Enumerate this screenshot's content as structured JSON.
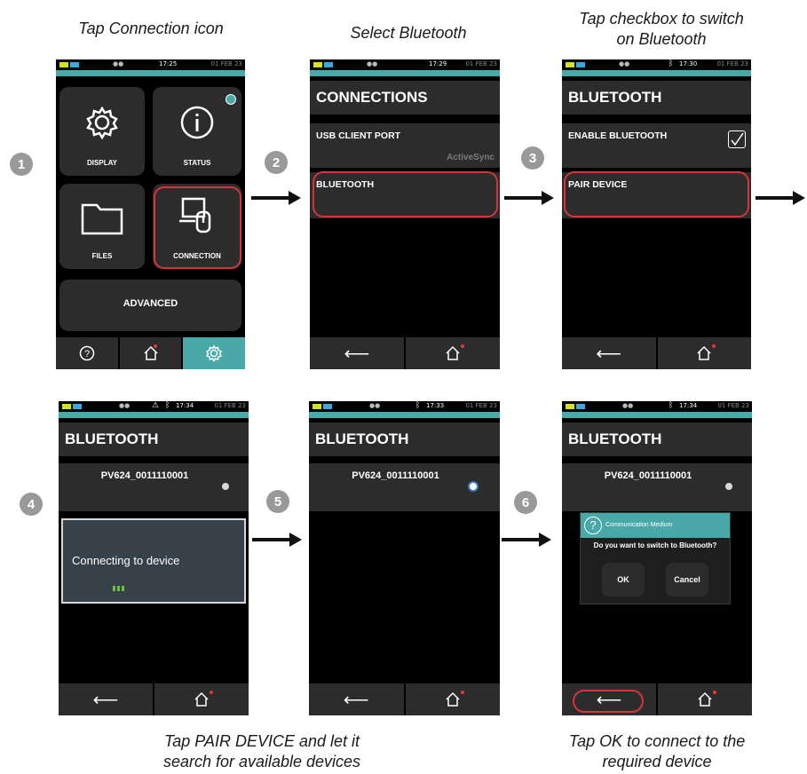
{
  "captions": {
    "c1": "Tap Connection icon",
    "c2": "Select Bluetooth",
    "c3a": "Tap checkbox to switch",
    "c3b": "on Bluetooth",
    "c5a": "Tap PAIR DEVICE and let it",
    "c5b": "search for available devices",
    "c6a": "Tap OK to connect to the",
    "c6b": "required device"
  },
  "steps": [
    "1",
    "2",
    "3",
    "4",
    "5",
    "6"
  ],
  "colors": {
    "teal": "#48a9a8",
    "tile": "#2c2c2c",
    "highlight": "#d8333a",
    "progress": "#6cc23a"
  },
  "screens": {
    "s1": {
      "time": "17:25",
      "date": "01 FEB 23",
      "tiles": {
        "display": "DISPLAY",
        "status": "STATUS",
        "files": "FILES",
        "connection": "CONNECTION",
        "advanced": "ADVANCED"
      },
      "nav": [
        "help-icon",
        "home-icon",
        "settings-icon"
      ]
    },
    "s2": {
      "time": "17:29",
      "date": "01 FEB 23",
      "title": "CONNECTIONS",
      "rows": {
        "usb": "USB CLIENT PORT",
        "usb_sub": "ActiveSync",
        "bluetooth": "BLUETOOTH"
      }
    },
    "s3": {
      "time": "17:30",
      "date": "01 FEB 23",
      "title": "BLUETOOTH",
      "rows": {
        "enable": "ENABLE BLUETOOTH",
        "pair": "PAIR DEVICE"
      }
    },
    "s4": {
      "time": "17:34",
      "date": "01 FEB 23",
      "title": "BLUETOOTH",
      "device": "PV624_0011110001",
      "connecting": "Connecting to device"
    },
    "s5": {
      "time": "17:33",
      "date": "01 FEB 23",
      "title": "BLUETOOTH",
      "device": "PV624_0011110001"
    },
    "s6": {
      "time": "17:34",
      "date": "01 FEB 23",
      "title": "BLUETOOTH",
      "device": "PV624_0011110001",
      "dialog": {
        "title": "Communication Medium",
        "message": "Do you want to switch to Bluetooth?",
        "ok": "OK",
        "cancel": "Cancel"
      }
    }
  }
}
